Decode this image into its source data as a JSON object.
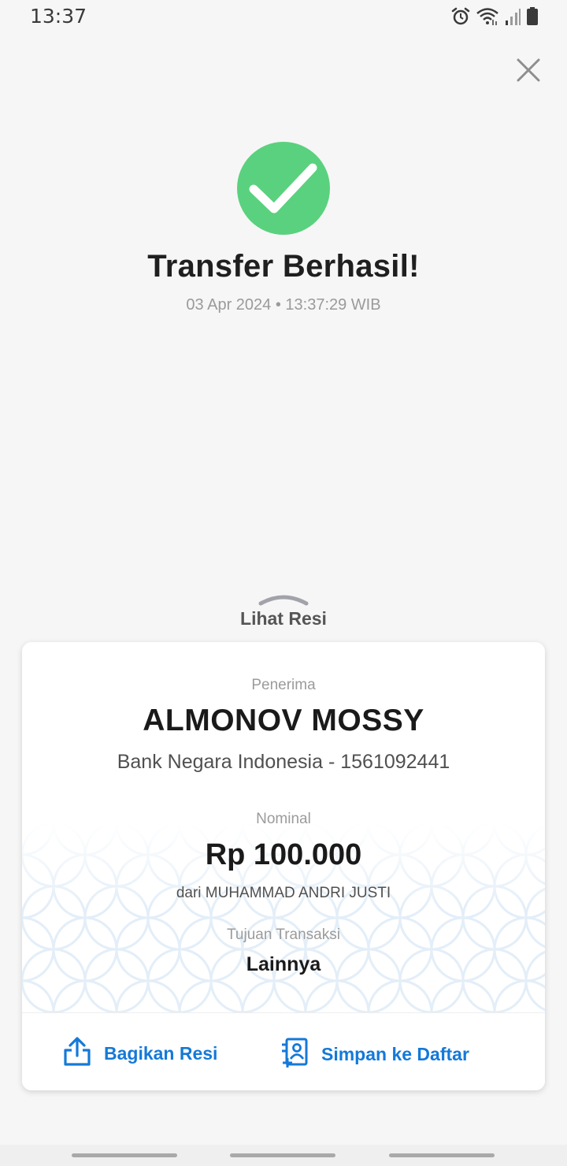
{
  "status_bar": {
    "time": "13:37",
    "icons": [
      "alarm-icon",
      "wifi-icon",
      "signal-icon",
      "battery-icon"
    ]
  },
  "header": {
    "close_icon": "close-icon"
  },
  "success": {
    "icon": "check-circle-icon",
    "icon_color": "#5ad17e",
    "title": "Transfer Berhasil!",
    "datetime": "03 Apr 2024 • 13:37:29 WIB"
  },
  "receipt_toggle": {
    "label": "Lihat Resi",
    "icon": "chevron-up-icon"
  },
  "receipt": {
    "recipient_label": "Penerima",
    "recipient_name": "ALMONOV MOSSY",
    "recipient_bank": "Bank Negara Indonesia - 1561092441",
    "amount_label": "Nominal",
    "amount": "Rp 100.000",
    "sender": "dari MUHAMMAD ANDRI JUSTI",
    "purpose_label": "Tujuan Transaksi",
    "purpose": "Lainnya"
  },
  "actions": {
    "share_label": "Bagikan Resi",
    "share_icon": "share-icon",
    "save_label": "Simpan ke Daftar",
    "save_icon": "contact-add-icon",
    "accent_color": "#1479d8"
  }
}
